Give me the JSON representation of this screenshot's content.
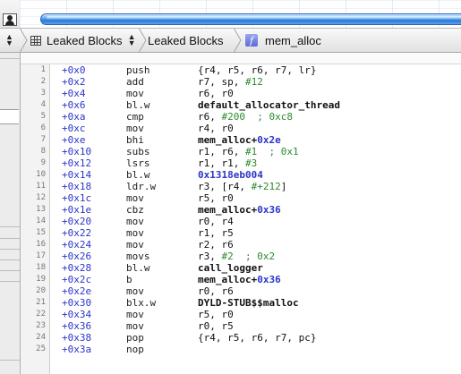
{
  "jump_bar": {
    "items": [
      {
        "label": "Leaked Blocks"
      },
      {
        "label": "Leaked Blocks"
      },
      {
        "label": "mem_alloc"
      }
    ],
    "function_icon_glyph": "f"
  },
  "disassembly": [
    {
      "n": "1",
      "off": "+0x0",
      "mn": "push",
      "ops": [
        {
          "t": "{r4, r5, r6, r7, lr}"
        }
      ]
    },
    {
      "n": "2",
      "off": "+0x2",
      "mn": "add",
      "ops": [
        {
          "t": "r7, sp, "
        },
        {
          "t": "#12",
          "k": "num"
        }
      ]
    },
    {
      "n": "3",
      "off": "+0x4",
      "mn": "mov",
      "ops": [
        {
          "t": "r6, r0"
        }
      ]
    },
    {
      "n": "4",
      "off": "+0x6",
      "mn": "bl.w",
      "ops": [
        {
          "t": "default_allocator_thread",
          "k": "sym"
        }
      ]
    },
    {
      "n": "5",
      "off": "+0xa",
      "mn": "cmp",
      "ops": [
        {
          "t": "r6, "
        },
        {
          "t": "#200",
          "k": "num"
        },
        {
          "t": "  ; 0xc8",
          "k": "cmt"
        }
      ]
    },
    {
      "n": "6",
      "off": "+0xc",
      "mn": "mov",
      "ops": [
        {
          "t": "r4, r0"
        }
      ]
    },
    {
      "n": "7",
      "off": "+0xe",
      "mn": "bhi",
      "ops": [
        {
          "t": "mem_alloc+",
          "k": "sym"
        },
        {
          "t": "0x2e",
          "k": "hex"
        }
      ]
    },
    {
      "n": "8",
      "off": "+0x10",
      "mn": "subs",
      "ops": [
        {
          "t": "r1, r6, "
        },
        {
          "t": "#1",
          "k": "num"
        },
        {
          "t": "  ; 0x1",
          "k": "cmt"
        }
      ]
    },
    {
      "n": "9",
      "off": "+0x12",
      "mn": "lsrs",
      "ops": [
        {
          "t": "r1, r1, "
        },
        {
          "t": "#3",
          "k": "num"
        }
      ]
    },
    {
      "n": "10",
      "off": "+0x14",
      "mn": "bl.w",
      "ops": [
        {
          "t": "0x1318eb004",
          "k": "hex"
        }
      ]
    },
    {
      "n": "11",
      "off": "+0x18",
      "mn": "ldr.w",
      "ops": [
        {
          "t": "r3, [r4, "
        },
        {
          "t": "#+212",
          "k": "num"
        },
        {
          "t": "]"
        }
      ]
    },
    {
      "n": "12",
      "off": "+0x1c",
      "mn": "mov",
      "ops": [
        {
          "t": "r5, r0"
        }
      ]
    },
    {
      "n": "13",
      "off": "+0x1e",
      "mn": "cbz",
      "ops": [
        {
          "t": "mem_alloc+",
          "k": "sym"
        },
        {
          "t": "0x36",
          "k": "hex"
        }
      ]
    },
    {
      "n": "14",
      "off": "+0x20",
      "mn": "mov",
      "ops": [
        {
          "t": "r0, r4"
        }
      ]
    },
    {
      "n": "15",
      "off": "+0x22",
      "mn": "mov",
      "ops": [
        {
          "t": "r1, r5"
        }
      ]
    },
    {
      "n": "16",
      "off": "+0x24",
      "mn": "mov",
      "ops": [
        {
          "t": "r2, r6"
        }
      ]
    },
    {
      "n": "17",
      "off": "+0x26",
      "mn": "movs",
      "ops": [
        {
          "t": "r3, "
        },
        {
          "t": "#2",
          "k": "num"
        },
        {
          "t": "  ; 0x2",
          "k": "cmt"
        }
      ]
    },
    {
      "n": "18",
      "off": "+0x28",
      "mn": "bl.w",
      "ops": [
        {
          "t": "call_logger",
          "k": "sym"
        }
      ]
    },
    {
      "n": "19",
      "off": "+0x2c",
      "mn": "b",
      "ops": [
        {
          "t": "mem_alloc+",
          "k": "sym"
        },
        {
          "t": "0x36",
          "k": "hex"
        }
      ]
    },
    {
      "n": "20",
      "off": "+0x2e",
      "mn": "mov",
      "ops": [
        {
          "t": "r0, r6"
        }
      ]
    },
    {
      "n": "21",
      "off": "+0x30",
      "mn": "blx.w",
      "ops": [
        {
          "t": "DYLD-STUB$$malloc",
          "k": "sym"
        }
      ]
    },
    {
      "n": "22",
      "off": "+0x34",
      "mn": "mov",
      "ops": [
        {
          "t": "r5, r0"
        }
      ]
    },
    {
      "n": "23",
      "off": "+0x36",
      "mn": "mov",
      "ops": [
        {
          "t": "r0, r5"
        }
      ]
    },
    {
      "n": "24",
      "off": "+0x38",
      "mn": "pop",
      "ops": [
        {
          "t": "{r4, r5, r6, r7, pc}"
        }
      ]
    },
    {
      "n": "25",
      "off": "+0x3a",
      "mn": "nop",
      "ops": []
    }
  ],
  "colors": {
    "offset": "#2b35c8",
    "immediate": "#2d8a2d",
    "symbol": "#111111",
    "address": "#2b35c8",
    "track_bar": "#2a79d9"
  }
}
